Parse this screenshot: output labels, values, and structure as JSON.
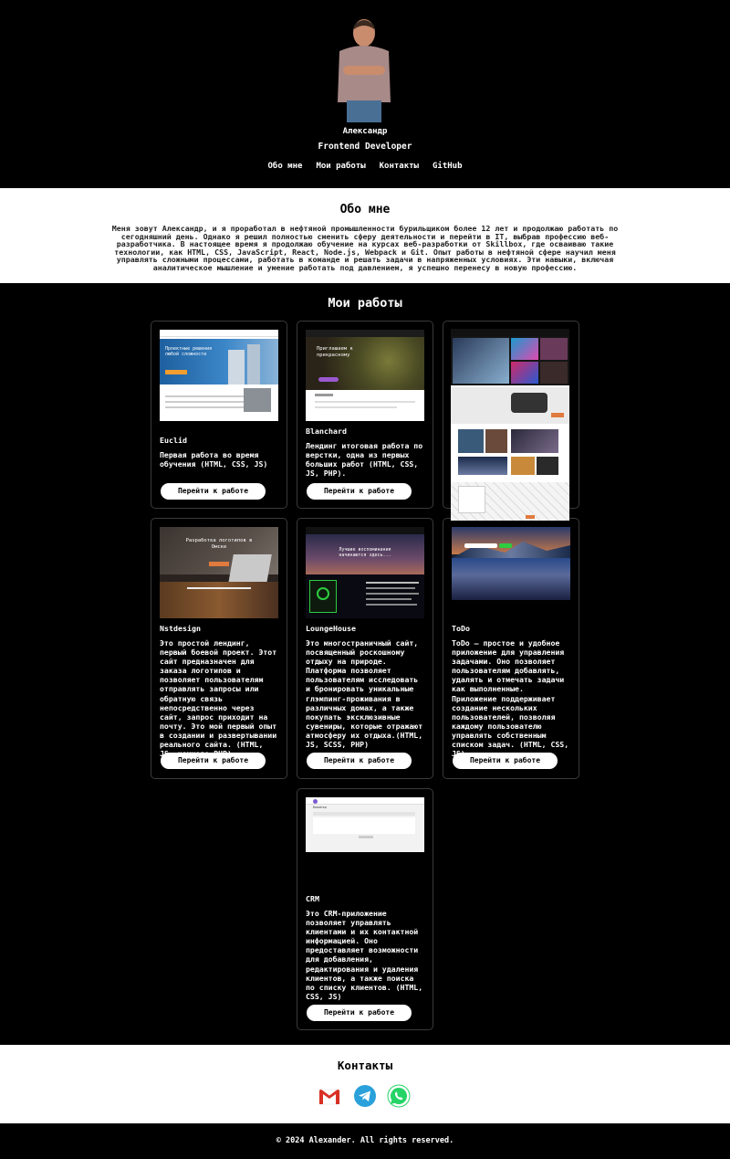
{
  "header": {
    "name": "Александр",
    "role": "Frontend Developer",
    "nav": [
      "Обо мне",
      "Мои работы",
      "Контакты",
      "GitHub"
    ]
  },
  "about": {
    "title": "Обо мне",
    "text": "Меня зовут Александр, и я проработал в нефтяной промышленности бурильщиком более 12 лет и продолжаю работать по сегодняшний день. Однако я решил полностью сменить сферу деятельности и перейти в IT, выбрав профессию веб-разработчика. В настоящее время я продолжаю обучение на курсах веб-разработки от Skillbox, где осваиваю такие технологии, как HTML, CSS, JavaScript, React, Node.js, Webpack и Git. Опыт работы в нефтяной сфере научил меня управлять сложными процессами, работать в команде и решать задачи в напряженных условиях. Эти навыки, включая аналитическое мышление и умение работать под давлением, я успешно перенесу в новую профессию."
  },
  "works": {
    "title": "Мои работы",
    "button_label": "Перейти к работе",
    "items": [
      {
        "title": "Euclid",
        "description": "Первая работа во время обучения (HTML, CSS, JS)",
        "thumb_hero": "Проектные решения любой сложности"
      },
      {
        "title": "Blanchard",
        "description": "Лендинг итоговая работа по верстки, одна из первых больших работ (HTML, CSS, JS, PHP).",
        "thumb_hero": "Приглашаем к прекрасному"
      },
      {
        "title": "",
        "description": "",
        "thumb_hero": ""
      },
      {
        "title": "Nstdesign",
        "description": "Это простой лендинг, первый боевой проект. Этот сайт предназначен для заказа логотипов и позволяет пользователям отправлять запросы или обратную связь непосредственно через сайт, запрос приходит на почту. Это мой первый опыт в создании и развертывании реального сайта. (HTML, JS, немного PHP)",
        "thumb_hero": "Разработка логотипов в Омске"
      },
      {
        "title": "LoungeHouse",
        "description": "Это многостраничный сайт, посвященный роскошному отдыху на природе. Платформа позволяет пользователям исследовать и бронировать уникальные глэмпинг-проживания в различных домах, а также покупать эксклюзивные сувениры, которые отражают атмосферу их отдыха.(HTML, JS, SCSS, PHP)",
        "thumb_hero": "Лучшие воспоминания начинаются здесь..."
      },
      {
        "title": "ToDo",
        "description": "ToDo — простое и удобное приложение для управления задачами. Оно позволяет пользователям добавлять, удалять и отмечать задачи как выполненные. Приложение поддерживает создание нескольких пользователей, позволяя каждому пользователю управлять собственным списком задач. (HTML, CSS, JS)",
        "thumb_hero": ""
      },
      {
        "title": "CRM",
        "description": "Это CRM-приложение позволяет управлять клиентами и их контактной информацией. Оно предоставляет возможности для добавления, редактирования и удаления клиентов, а также поиска по списку клиентов. (HTML, CSS, JS)",
        "thumb_hero": "Клиенты"
      }
    ]
  },
  "contacts": {
    "title": "Контакты",
    "icons": [
      "gmail-icon",
      "telegram-icon",
      "whatsapp-icon"
    ]
  },
  "footer": {
    "text": "© 2024 Alexander. All rights reserved."
  },
  "colors": {
    "accent_blue": "#2aa1da",
    "whatsapp": "#25d366",
    "gmail_red": "#d93025"
  }
}
